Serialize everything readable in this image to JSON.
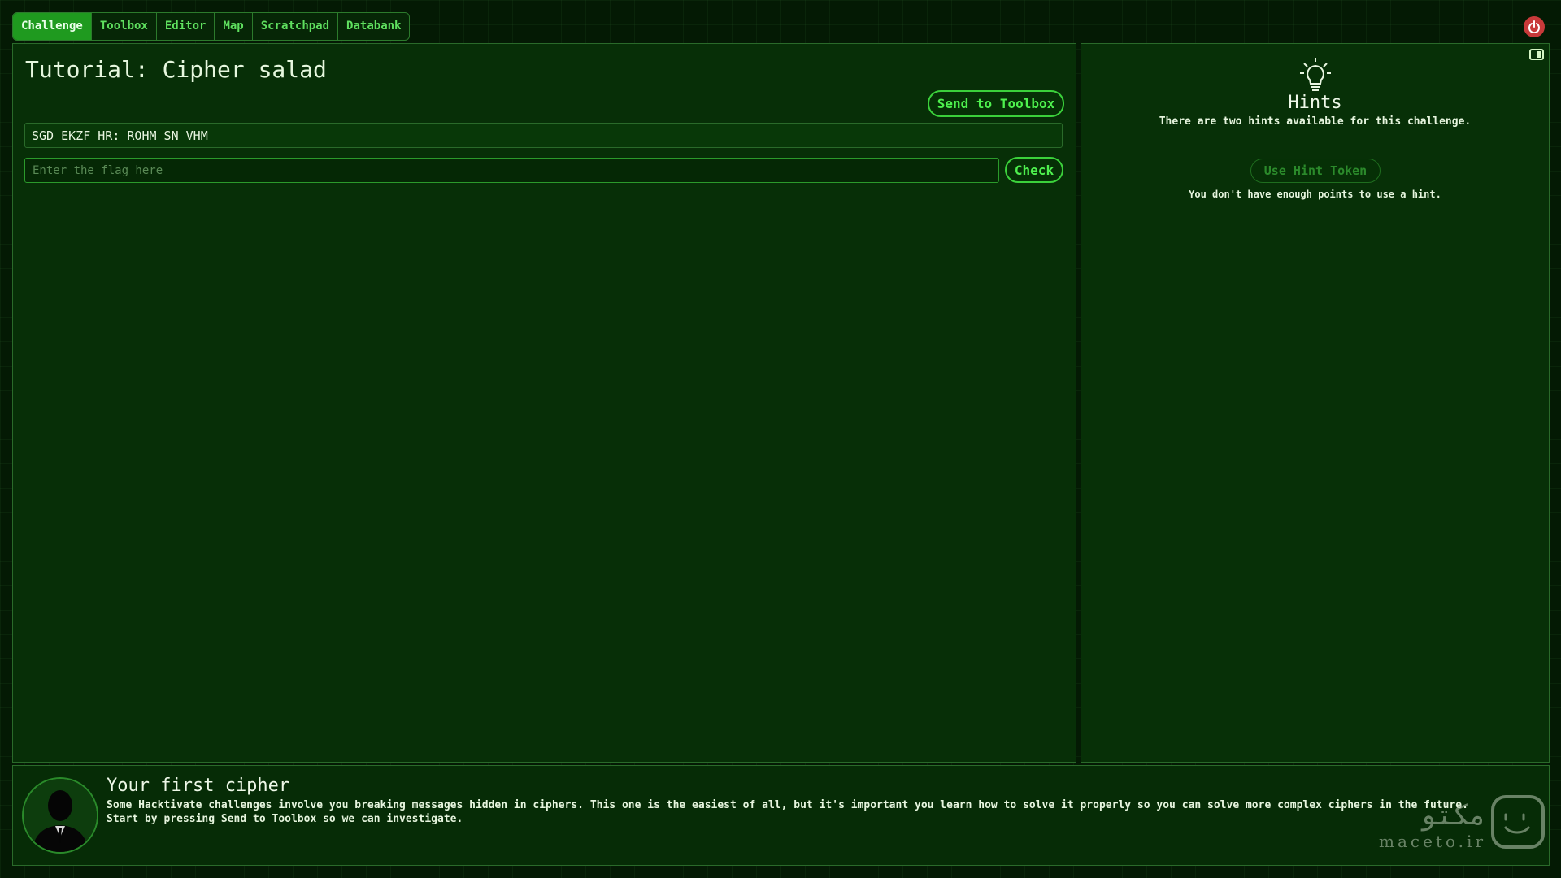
{
  "nav": {
    "tabs": [
      {
        "label": "Challenge",
        "active": true
      },
      {
        "label": "Toolbox",
        "active": false
      },
      {
        "label": "Editor",
        "active": false
      },
      {
        "label": "Map",
        "active": false
      },
      {
        "label": "Scratchpad",
        "active": false
      },
      {
        "label": "Databank",
        "active": false
      }
    ],
    "power_icon": "power-icon"
  },
  "challenge": {
    "title": "Tutorial: Cipher salad",
    "send_label": "Send to Toolbox",
    "cipher_text": "SGD EKZF HR: ROHM SN VHM",
    "flag_placeholder": "Enter the flag here",
    "check_label": "Check"
  },
  "hints": {
    "icon": "lightbulb-icon",
    "title": "Hints",
    "subtitle": "There are two hints available for this challenge.",
    "button_label": "Use Hint Token",
    "note": "You don't have enough points to use a hint."
  },
  "dialog": {
    "title": "Your first cipher",
    "line1": "Some Hacktivate challenges involve you breaking messages hidden in ciphers. This one is the easiest of all, but it's important you learn how to solve it properly so you can solve more complex ciphers in the future.",
    "line2": "Start by pressing Send to Toolbox so we can investigate."
  },
  "watermark": {
    "arabic": "مکتو",
    "latin": "maceto.ir"
  },
  "colors": {
    "accent": "#3bd13b",
    "active_tab": "#1f9a1f",
    "power": "#c83a3a"
  }
}
